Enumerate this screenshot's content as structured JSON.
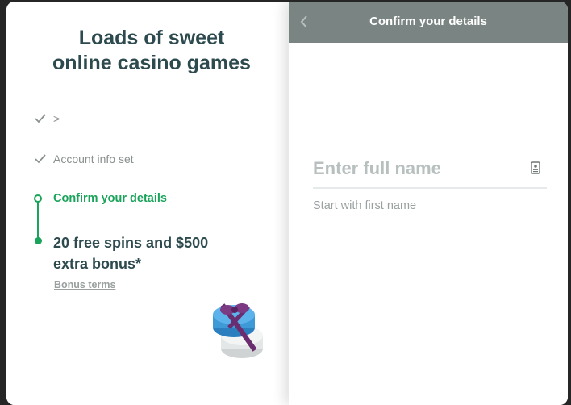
{
  "left": {
    "headline_line1": "Loads of sweet",
    "headline_line2": "online casino games",
    "steps": [
      {
        "label": ">",
        "status": "done"
      },
      {
        "label": "Account info set",
        "status": "done"
      },
      {
        "label": "Confirm your details",
        "status": "current"
      }
    ],
    "bonus_line1": "20 free spins and $500",
    "bonus_line2": "extra bonus*",
    "terms_link": "Bonus terms"
  },
  "right": {
    "header_title": "Confirm your details",
    "name_field": {
      "placeholder": "Enter full name",
      "value": ""
    },
    "hint": "Start with first name"
  },
  "colors": {
    "accent_green": "#1aa35a",
    "text_dark": "#2d4a4f",
    "header_gray": "#7a8482"
  },
  "icons": [
    "check-icon",
    "back-chevron-icon",
    "id-card-icon",
    "gift-chips-icon"
  ]
}
